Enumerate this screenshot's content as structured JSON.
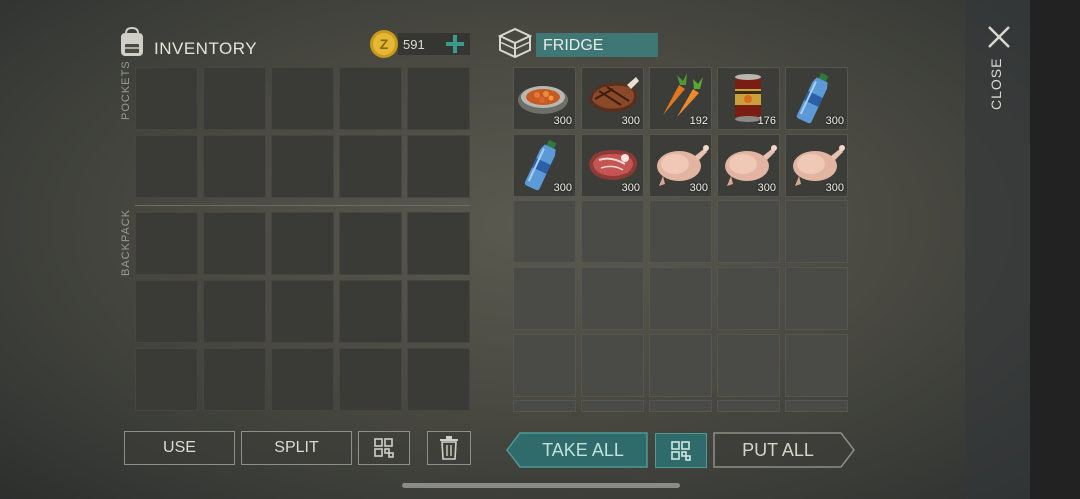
{
  "inventory": {
    "title": "INVENTORY",
    "coins": "591",
    "pockets_label": "POCKETS",
    "backpack_label": "BACKPACK"
  },
  "container": {
    "title": "FRIDGE",
    "items": [
      {
        "name": "stew-bowl",
        "qty": "300"
      },
      {
        "name": "steak",
        "qty": "300"
      },
      {
        "name": "carrots",
        "qty": "192"
      },
      {
        "name": "canned-food",
        "qty": "176"
      },
      {
        "name": "water-bottle",
        "qty": "300"
      },
      {
        "name": "water-bottle",
        "qty": "300"
      },
      {
        "name": "raw-meat",
        "qty": "300"
      },
      {
        "name": "raw-chicken",
        "qty": "300"
      },
      {
        "name": "raw-chicken",
        "qty": "300"
      },
      {
        "name": "raw-chicken",
        "qty": "300"
      }
    ]
  },
  "buttons": {
    "use": "USE",
    "split": "SPLIT",
    "take_all": "TAKE ALL",
    "put_all": "PUT ALL",
    "close": "CLOSE"
  },
  "colors": {
    "accent_teal": "#2f6b6b",
    "title_box": "#3f7775"
  }
}
